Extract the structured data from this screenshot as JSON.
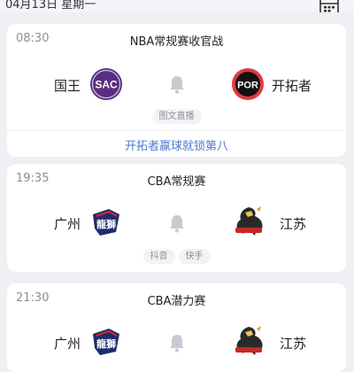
{
  "header": {
    "date": "04月13日 星期一",
    "calendar_icon": "calendar-icon"
  },
  "colors": {
    "accent": "#4a7bd1",
    "background": "#eef0f4"
  },
  "games": [
    {
      "time": "08:30",
      "league": "NBA常规赛收官战",
      "home": {
        "name": "国王",
        "logo_text": "SAC",
        "logo_icon": "sac-logo-icon"
      },
      "away": {
        "name": "开拓者",
        "logo_text": "POR",
        "logo_icon": "por-logo-icon"
      },
      "broadcasts": [
        "图文直播"
      ],
      "news": "开拓者赢球就锁第八"
    },
    {
      "time": "19:35",
      "league": "CBA常规赛",
      "home": {
        "name": "广州",
        "logo_text": "龍獅",
        "logo_icon": "guangzhou-logo-icon"
      },
      "away": {
        "name": "江苏",
        "logo_icon": "jiangsu-dragon-logo-icon"
      },
      "broadcasts": [
        "抖音",
        "快手"
      ]
    },
    {
      "time": "21:30",
      "league": "CBA潜力赛",
      "home": {
        "name": "广州",
        "logo_text": "龍獅",
        "logo_icon": "guangzhou-logo-icon"
      },
      "away": {
        "name": "江苏",
        "logo_icon": "jiangsu-dragon-logo-icon"
      }
    }
  ]
}
